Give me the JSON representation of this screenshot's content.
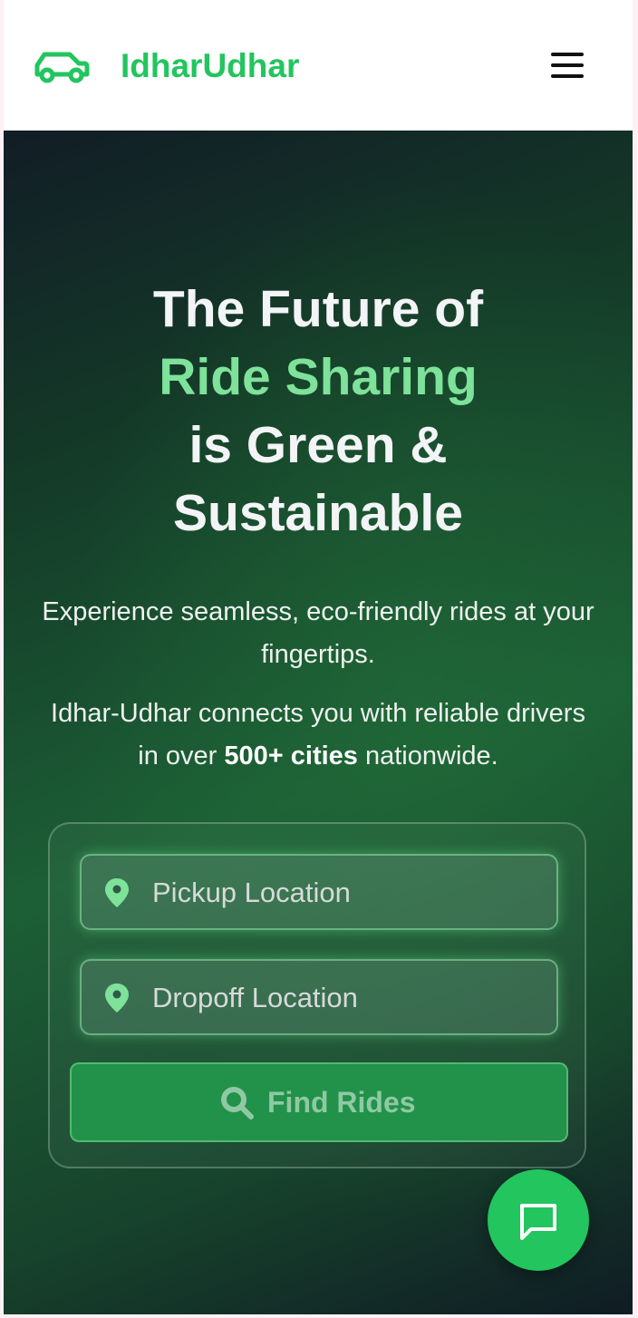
{
  "header": {
    "brand": "IdharUdhar",
    "logo_icon": "car-icon",
    "menu_icon": "hamburger-menu-icon"
  },
  "hero": {
    "title_line1": "The Future of",
    "title_accent": "Ride Sharing",
    "title_line3": "is Green &",
    "title_line4": "Sustainable",
    "subtitle": "Experience seamless, eco-friendly rides at your fingertips.",
    "body_prefix": "Idhar-Udhar connects you with reliable drivers in over ",
    "body_bold": "500+ cities",
    "body_suffix": " nationwide."
  },
  "search": {
    "pickup_placeholder": "Pickup Location",
    "dropoff_placeholder": "Dropoff Location",
    "find_label": "Find Rides",
    "pin_icon": "map-pin-icon",
    "search_icon": "search-icon"
  },
  "chat": {
    "icon": "chat-bubble-icon"
  },
  "colors": {
    "brand": "#22c55e",
    "accent_text": "#7ee29a",
    "button": "#22914a",
    "hero_dark": "#121d26",
    "hero_green": "#1c5f36"
  }
}
